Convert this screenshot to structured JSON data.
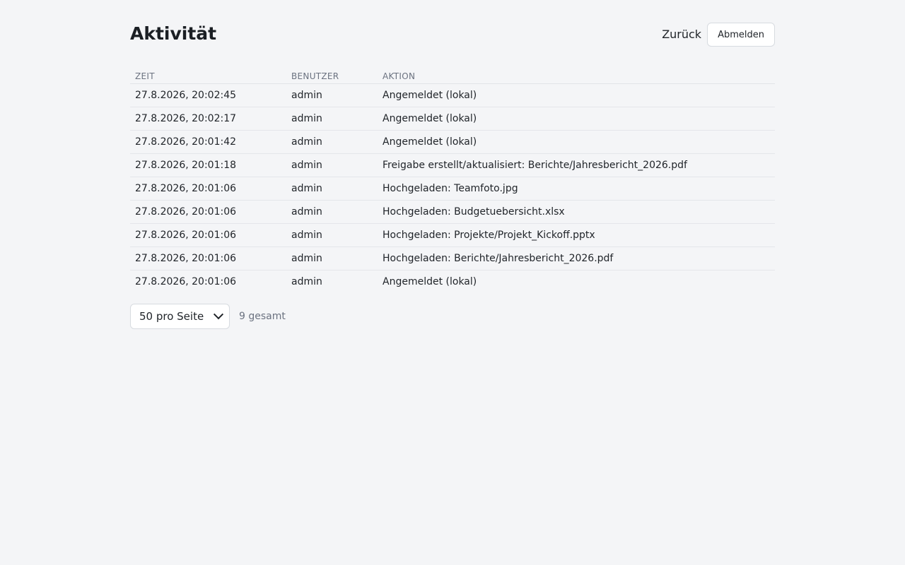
{
  "header": {
    "title": "Aktivität",
    "back_label": "Zurück",
    "logout_label": "Abmelden"
  },
  "table": {
    "columns": [
      "ZEIT",
      "BENUTZER",
      "AKTION"
    ],
    "rows": [
      {
        "time": "27.8.2026, 20:02:45",
        "user": "admin",
        "action": "Angemeldet (lokal)"
      },
      {
        "time": "27.8.2026, 20:02:17",
        "user": "admin",
        "action": "Angemeldet (lokal)"
      },
      {
        "time": "27.8.2026, 20:01:42",
        "user": "admin",
        "action": "Angemeldet (lokal)"
      },
      {
        "time": "27.8.2026, 20:01:18",
        "user": "admin",
        "action": "Freigabe erstellt/aktualisiert: Berichte/Jahresbericht_2026.pdf"
      },
      {
        "time": "27.8.2026, 20:01:06",
        "user": "admin",
        "action": "Hochgeladen: Teamfoto.jpg"
      },
      {
        "time": "27.8.2026, 20:01:06",
        "user": "admin",
        "action": "Hochgeladen: Budgetuebersicht.xlsx"
      },
      {
        "time": "27.8.2026, 20:01:06",
        "user": "admin",
        "action": "Hochgeladen: Projekte/Projekt_Kickoff.pptx"
      },
      {
        "time": "27.8.2026, 20:01:06",
        "user": "admin",
        "action": "Hochgeladen: Berichte/Jahresbericht_2026.pdf"
      },
      {
        "time": "27.8.2026, 20:01:06",
        "user": "admin",
        "action": "Angemeldet (lokal)"
      }
    ]
  },
  "footer": {
    "page_size_selected": "50 pro Seite",
    "total_label": "9 gesamt"
  },
  "icons": {
    "select_arrow": "chevron-down-icon"
  },
  "colors": {
    "background": "#f4f5f7",
    "muted_text": "#6b7280",
    "border": "#d7dbe0"
  }
}
